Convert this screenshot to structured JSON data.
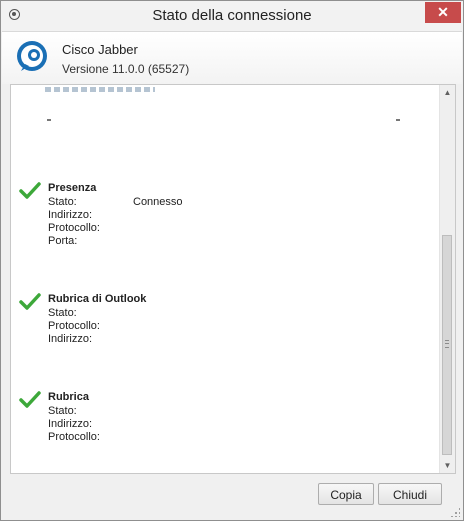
{
  "window": {
    "title": "Stato della connessione",
    "close_label": "✕"
  },
  "header": {
    "app_name": "Cisco Jabber",
    "app_version": "Versione 11.0.0 (65527)"
  },
  "sections": {
    "presence": {
      "title": "Presenza",
      "rows": [
        {
          "label": "Stato:",
          "value": "Connesso"
        },
        {
          "label": "Indirizzo:",
          "value": ""
        },
        {
          "label": "Protocollo:",
          "value": ""
        },
        {
          "label": "Porta:",
          "value": ""
        }
      ]
    },
    "outlook": {
      "title": "Rubrica di Outlook",
      "rows": [
        {
          "label": "Stato:",
          "value": ""
        },
        {
          "label": "Protocollo:",
          "value": ""
        },
        {
          "label": "Indirizzo:",
          "value": ""
        }
      ]
    },
    "directory": {
      "title": "Rubrica",
      "rows": [
        {
          "label": "Stato:",
          "value": ""
        },
        {
          "label": "Indirizzo:",
          "value": ""
        },
        {
          "label": "Protocollo:",
          "value": ""
        }
      ]
    }
  },
  "buttons": {
    "copy": "Copia",
    "close": "Chiudi"
  },
  "colors": {
    "check_green": "#3da83a",
    "close_button": "#c74b4b",
    "logo_blue": "#1a6fb5"
  }
}
